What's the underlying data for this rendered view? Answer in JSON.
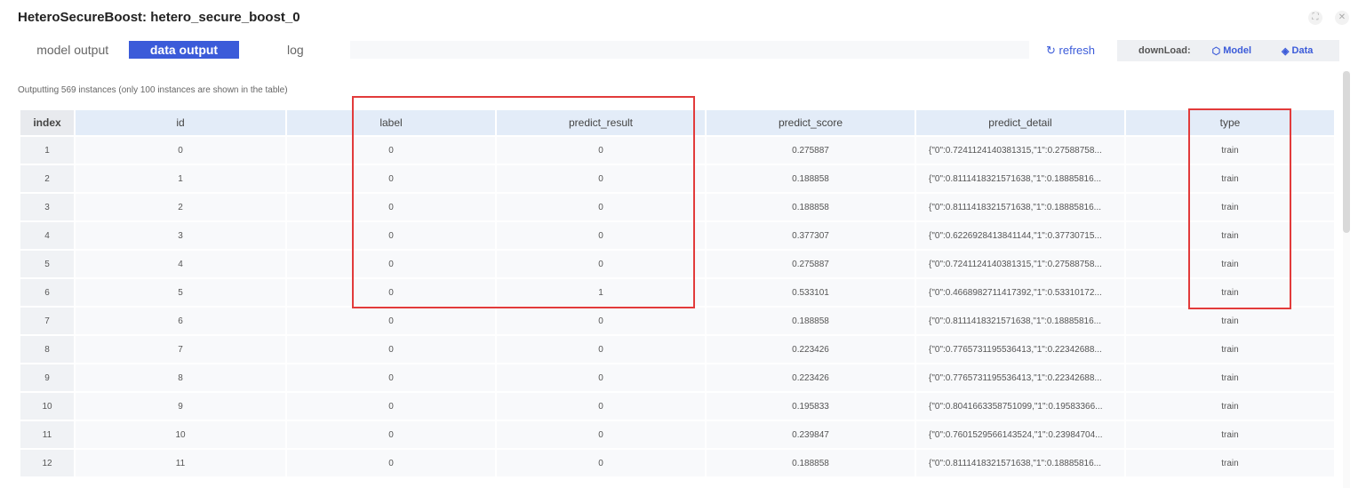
{
  "window": {
    "title": "HeteroSecureBoost: hetero_secure_boost_0",
    "icons": [
      "fullscreen-icon",
      "close-icon"
    ]
  },
  "tabs": [
    {
      "label": "model output",
      "active": false
    },
    {
      "label": "data output",
      "active": true
    },
    {
      "label": "log",
      "active": false
    }
  ],
  "toolbar": {
    "refresh_label": "refresh",
    "download_label": "downLoad:",
    "model_label": "Model",
    "data_label": "Data"
  },
  "info": {
    "outputting_text": "Outputting 569 instances (only 100 instances are shown in the table)"
  },
  "table": {
    "columns": [
      "index",
      "id",
      "label",
      "predict_result",
      "predict_score",
      "predict_detail",
      "type"
    ],
    "rows": [
      [
        "1",
        "0",
        "0",
        "0",
        "0.275887",
        "{\"0\":0.7241124140381315,\"1\":0.27588758...",
        "train"
      ],
      [
        "2",
        "1",
        "0",
        "0",
        "0.188858",
        "{\"0\":0.8111418321571638,\"1\":0.18885816...",
        "train"
      ],
      [
        "3",
        "2",
        "0",
        "0",
        "0.188858",
        "{\"0\":0.8111418321571638,\"1\":0.18885816...",
        "train"
      ],
      [
        "4",
        "3",
        "0",
        "0",
        "0.377307",
        "{\"0\":0.6226928413841144,\"1\":0.37730715...",
        "train"
      ],
      [
        "5",
        "4",
        "0",
        "0",
        "0.275887",
        "{\"0\":0.7241124140381315,\"1\":0.27588758...",
        "train"
      ],
      [
        "6",
        "5",
        "0",
        "1",
        "0.533101",
        "{\"0\":0.4668982711417392,\"1\":0.53310172...",
        "train"
      ],
      [
        "7",
        "6",
        "0",
        "0",
        "0.188858",
        "{\"0\":0.8111418321571638,\"1\":0.18885816...",
        "train"
      ],
      [
        "8",
        "7",
        "0",
        "0",
        "0.223426",
        "{\"0\":0.7765731195536413,\"1\":0.22342688...",
        "train"
      ],
      [
        "9",
        "8",
        "0",
        "0",
        "0.223426",
        "{\"0\":0.7765731195536413,\"1\":0.22342688...",
        "train"
      ],
      [
        "10",
        "9",
        "0",
        "0",
        "0.195833",
        "{\"0\":0.8041663358751099,\"1\":0.19583366...",
        "train"
      ],
      [
        "11",
        "10",
        "0",
        "0",
        "0.239847",
        "{\"0\":0.7601529566143524,\"1\":0.23984704...",
        "train"
      ],
      [
        "12",
        "11",
        "0",
        "0",
        "0.188858",
        "{\"0\":0.8111418321571638,\"1\":0.18885816...",
        "train"
      ]
    ]
  },
  "colors": {
    "accent": "#3b5bd9",
    "highlight": "#e23b3b",
    "header_bg": "#e3ecf8"
  }
}
